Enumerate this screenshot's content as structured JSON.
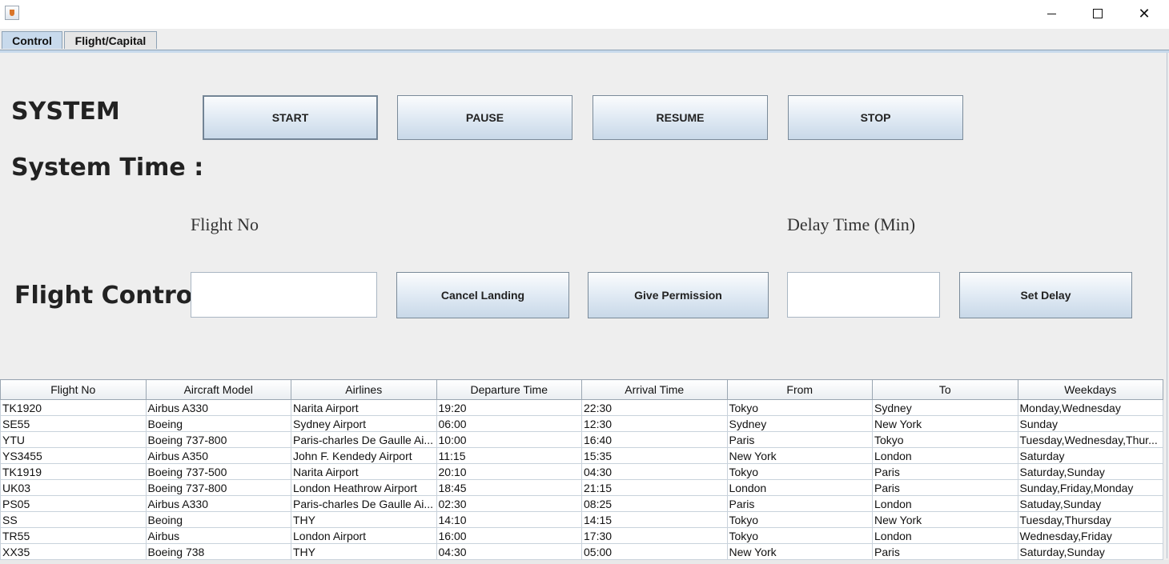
{
  "window": {
    "minimize_glyph": "—",
    "maximize_glyph": "□",
    "close_glyph": "✕"
  },
  "tabs": [
    {
      "label": "Control"
    },
    {
      "label": "Flight/Capital"
    }
  ],
  "labels": {
    "system": "SYSTEM",
    "system_time": "System Time :",
    "flight_control": "Flight Control",
    "flight_no": "Flight No",
    "delay_time": "Delay Time (Min)"
  },
  "buttons": {
    "start": "START",
    "pause": "PAUSE",
    "resume": "RESUME",
    "stop": "STOP",
    "cancel_landing": "Cancel Landing",
    "give_permission": "Give Permission",
    "set_delay": "Set Delay"
  },
  "inputs": {
    "flight_no_value": "",
    "delay_time_value": ""
  },
  "table": {
    "columns": [
      "Flight No",
      "Aircraft Model",
      "Airlines",
      "Departure Time",
      "Arrival Time",
      "From",
      "To",
      "Weekdays"
    ],
    "rows": [
      [
        "TK1920",
        "Airbus A330",
        "Narita Airport",
        "19:20",
        "22:30",
        "Tokyo",
        "Sydney",
        "Monday,Wednesday"
      ],
      [
        "SE55",
        "Boeing",
        "Sydney Airport",
        "06:00",
        "12:30",
        "Sydney",
        "New York",
        "Sunday"
      ],
      [
        "YTU",
        "Boeing 737-800",
        "Paris-charles De Gaulle Ai...",
        "10:00",
        "16:40",
        "Paris",
        "Tokyo",
        "Tuesday,Wednesday,Thur..."
      ],
      [
        "YS3455",
        "Airbus A350",
        "John F. Kendedy Airport",
        "11:15",
        "15:35",
        "New York",
        "London",
        "Saturday"
      ],
      [
        "TK1919",
        "Boeing 737-500",
        "Narita Airport",
        "20:10",
        "04:30",
        "Tokyo",
        "Paris",
        "Saturday,Sunday"
      ],
      [
        "UK03",
        "Boeing 737-800",
        "London Heathrow Airport",
        "18:45",
        "21:15",
        "London",
        "Paris",
        "Sunday,Friday,Monday"
      ],
      [
        "PS05",
        "Airbus A330",
        "Paris-charles De Gaulle Ai...",
        "02:30",
        "08:25",
        "Paris",
        "London",
        "Satuday,Sunday"
      ],
      [
        "SS",
        "Beoing",
        "THY",
        "14:10",
        "14:15",
        "Tokyo",
        "New York",
        "Tuesday,Thursday"
      ],
      [
        "TR55",
        "Airbus",
        "London Airport",
        "16:00",
        "17:30",
        "Tokyo",
        "London",
        "Wednesday,Friday"
      ],
      [
        "XX35",
        "Boeing 738",
        "THY",
        "04:30",
        "05:00",
        "New York",
        "Paris",
        "Saturday,Sunday"
      ]
    ]
  }
}
